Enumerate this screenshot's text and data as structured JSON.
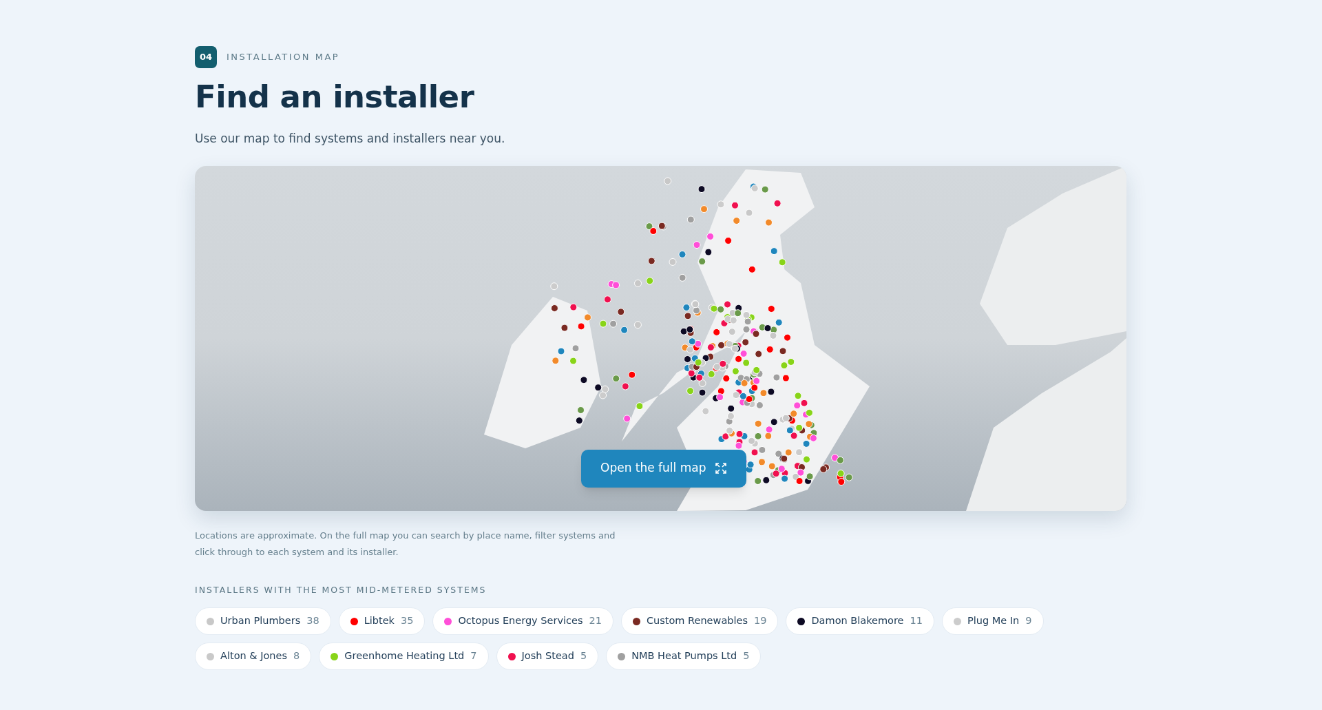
{
  "section": {
    "number": "04",
    "label": "INSTALLATION MAP"
  },
  "title": "Find an installer",
  "subtitle": "Use our map to find systems and installers near you.",
  "map": {
    "button": "Open the full map"
  },
  "caption": "Locations are approximate. On the full map you can search by place name, filter systems and click through to each system and its installer.",
  "installers_heading": "INSTALLERS WITH THE MOST MID-METERED SYSTEMS",
  "installers": [
    {
      "name": "Urban Plumbers",
      "count": "38",
      "color": "#c8c8c8"
    },
    {
      "name": "Libtek",
      "count": "35",
      "color": "#ff0000"
    },
    {
      "name": "Octopus Energy Services",
      "count": "21",
      "color": "#ff4fd8"
    },
    {
      "name": "Custom Renewables",
      "count": "19",
      "color": "#7a2a22"
    },
    {
      "name": "Damon Blakemore",
      "count": "11",
      "color": "#0d0a24"
    },
    {
      "name": "Plug Me In",
      "count": "9",
      "color": "#cccccc"
    },
    {
      "name": "Alton & Jones",
      "count": "8",
      "color": "#c9c9c9"
    },
    {
      "name": "Greenhome Heating Ltd",
      "count": "7",
      "color": "#88d418"
    },
    {
      "name": "Josh Stead",
      "count": "5",
      "color": "#f0104f"
    },
    {
      "name": "NMB Heat Pumps Ltd",
      "count": "5",
      "color": "#a0a0a0"
    }
  ]
}
